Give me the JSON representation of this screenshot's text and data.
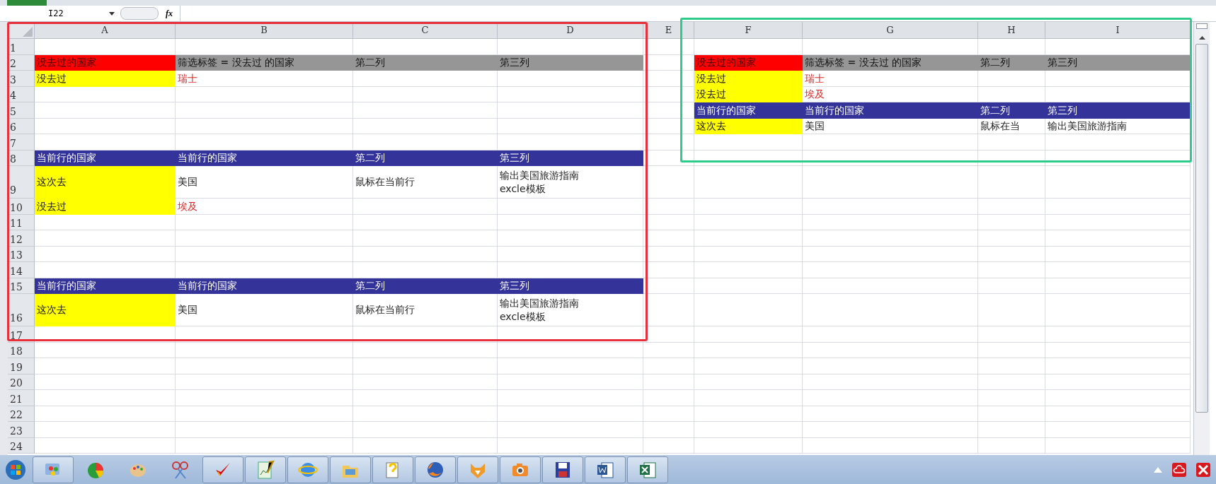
{
  "formula_bar": {
    "name_box": "I22",
    "function_label": "fx"
  },
  "columns": [
    "A",
    "B",
    "C",
    "D",
    "E",
    "F",
    "G",
    "H",
    "I"
  ],
  "rows": [
    {
      "number": "1"
    },
    {
      "number": "2",
      "cells": [
        {
          "text": "没去过的国家",
          "kind": "redfill"
        },
        {
          "text": "筛选标签 = 没去过 的国家",
          "kind": "grayfill"
        },
        {
          "text": "第二列",
          "kind": "grayfill"
        },
        {
          "text": "第三列",
          "kind": "grayfill"
        },
        {},
        {
          "text": "没去过的国家",
          "kind": "redfill"
        },
        {
          "text": "筛选标签 = 没去过 的国家",
          "kind": "grayfill"
        },
        {
          "text": "第二列",
          "kind": "grayfill"
        },
        {
          "text": "第三列",
          "kind": "grayfill"
        }
      ]
    },
    {
      "number": "3",
      "cells": [
        {
          "text": "没去过",
          "kind": "yellowfill"
        },
        {
          "text": "瑞士",
          "kind": "redtext"
        },
        {},
        {},
        {},
        {
          "text": "没去过",
          "kind": "yellowfill"
        },
        {
          "text": "瑞士",
          "kind": "redtext"
        },
        {},
        {}
      ]
    },
    {
      "number": "4",
      "cells": [
        {},
        {},
        {},
        {},
        {},
        {
          "text": "没去过",
          "kind": "yellowfill"
        },
        {
          "text": "埃及",
          "kind": "redtext"
        },
        {},
        {}
      ]
    },
    {
      "number": "5",
      "cells": [
        {},
        {},
        {},
        {},
        {},
        {
          "text": "当前行的国家",
          "kind": "navyfill"
        },
        {
          "text": "当前行的国家",
          "kind": "navyfill"
        },
        {
          "text": "第二列",
          "kind": "navyfill"
        },
        {
          "text": "第三列",
          "kind": "navyfill"
        }
      ]
    },
    {
      "number": "6",
      "cells": [
        {},
        {},
        {},
        {},
        {},
        {
          "text": "这次去",
          "kind": "yellowfill"
        },
        {
          "text": "美国",
          "kind": "plain"
        },
        {
          "text": "鼠标在当",
          "kind": "plain"
        },
        {
          "text": "输出美国旅游指南",
          "kind": "plain"
        }
      ]
    },
    {
      "number": "7"
    },
    {
      "number": "8",
      "cells": [
        {
          "text": "当前行的国家",
          "kind": "navyfill"
        },
        {
          "text": "当前行的国家",
          "kind": "navyfill"
        },
        {
          "text": "第二列",
          "kind": "navyfill"
        },
        {
          "text": "第三列",
          "kind": "navyfill"
        },
        {},
        {},
        {},
        {},
        {}
      ]
    },
    {
      "number": "9",
      "tall": true,
      "cells": [
        {
          "text": "这次去",
          "kind": "yellowfill"
        },
        {
          "text": "美国",
          "kind": "plain"
        },
        {
          "text": "鼠标在当前行",
          "kind": "plain"
        },
        {
          "text": "输出美国旅游指南\nexcle模板",
          "kind": "plain"
        },
        {},
        {},
        {},
        {},
        {}
      ]
    },
    {
      "number": "10",
      "cells": [
        {
          "text": "没去过",
          "kind": "yellowfill"
        },
        {
          "text": "埃及",
          "kind": "redtext"
        },
        {},
        {},
        {},
        {},
        {},
        {},
        {}
      ]
    },
    {
      "number": "11"
    },
    {
      "number": "12"
    },
    {
      "number": "13"
    },
    {
      "number": "14"
    },
    {
      "number": "15",
      "cells": [
        {
          "text": "当前行的国家",
          "kind": "navyfill"
        },
        {
          "text": "当前行的国家",
          "kind": "navyfill"
        },
        {
          "text": "第二列",
          "kind": "navyfill"
        },
        {
          "text": "第三列",
          "kind": "navyfill"
        },
        {},
        {},
        {},
        {},
        {}
      ]
    },
    {
      "number": "16",
      "tall": true,
      "cells": [
        {
          "text": "这次去",
          "kind": "yellowfill"
        },
        {
          "text": "美国",
          "kind": "plain"
        },
        {
          "text": "鼠标在当前行",
          "kind": "plain"
        },
        {
          "text": "输出美国旅游指南\nexcle模板",
          "kind": "plain"
        },
        {},
        {},
        {},
        {},
        {}
      ]
    },
    {
      "number": "17"
    },
    {
      "number": "18"
    },
    {
      "number": "19"
    },
    {
      "number": "20"
    },
    {
      "number": "21"
    },
    {
      "number": "22"
    },
    {
      "number": "23"
    },
    {
      "number": "24"
    }
  ],
  "taskbar": {
    "apps": [
      {
        "running": true
      },
      {
        "running": false
      },
      {
        "running": false
      },
      {
        "running": false
      },
      {
        "running": true
      },
      {
        "running": true
      },
      {
        "running": true
      },
      {
        "running": true
      },
      {
        "running": true
      },
      {
        "running": true
      },
      {
        "running": true
      },
      {
        "running": true
      },
      {
        "running": true
      },
      {
        "running": true
      },
      {
        "running": true
      }
    ]
  }
}
